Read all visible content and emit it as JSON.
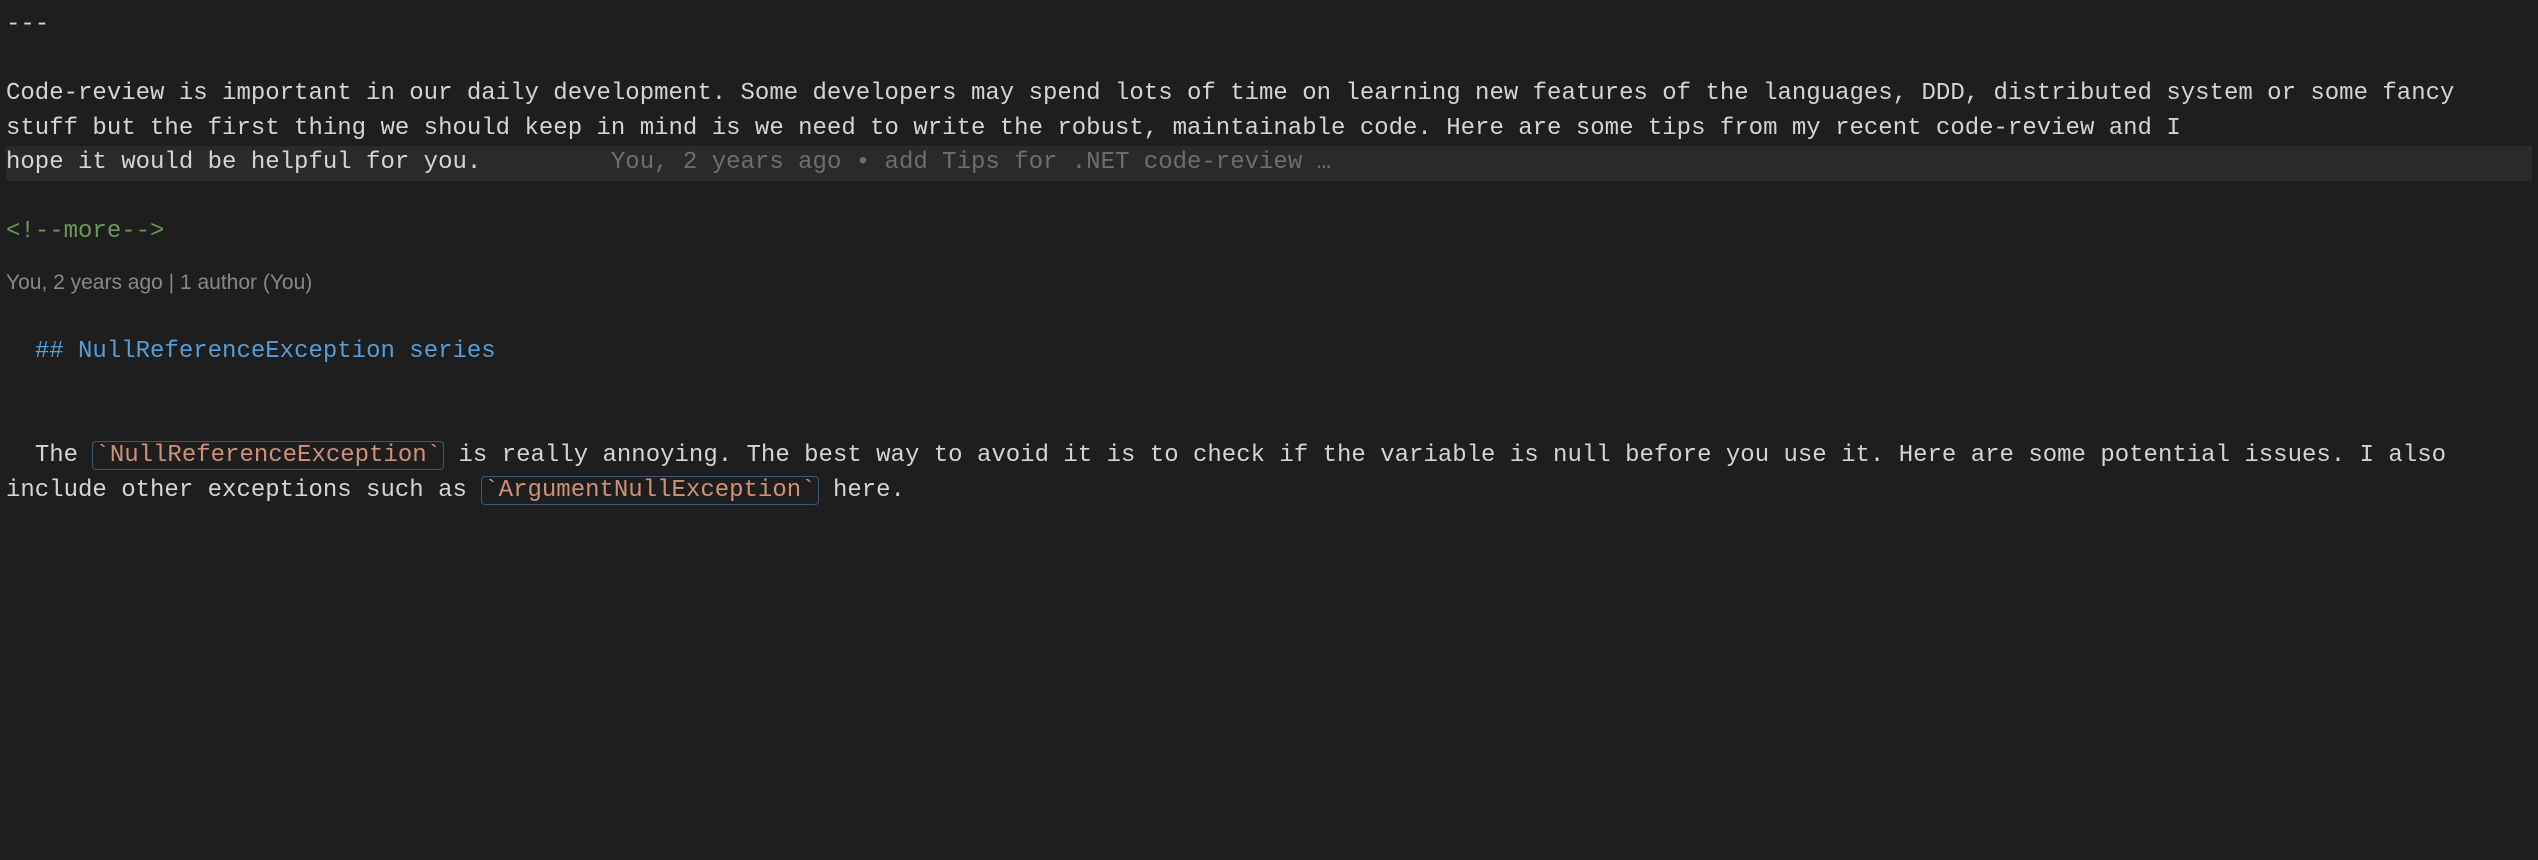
{
  "frontmatter_close": "---",
  "paragraph1_part1": "Code-review is important in our daily development. Some developers may spend lots of time on learning new features of the languages, DDD, distributed system or some fancy stuff but the first thing we should keep in ",
  "paragraph1_part2": "mind is we need to write the robust, maintainable code. Here are some tips from my recent code-review and I ",
  "paragraph1_last_line": "hope it would be helpful for you.",
  "blame_inline": "You, 2 years ago • add Tips for .NET code-review …",
  "more_comment": "<!--more-->",
  "codelens": "You, 2 years ago | 1 author (You)",
  "heading_prefix": "## ",
  "heading_text": "NullReferenceException series",
  "paragraph2_pre": "The ",
  "code1": "`NullReferenceException`",
  "paragraph2_mid": " is really annoying. The best way to avoid it is to check if the variable is null before you use it. Here are some potential issues. I also include other exceptions such as ",
  "code2": "`ArgumentNullException`",
  "paragraph2_post": " here."
}
